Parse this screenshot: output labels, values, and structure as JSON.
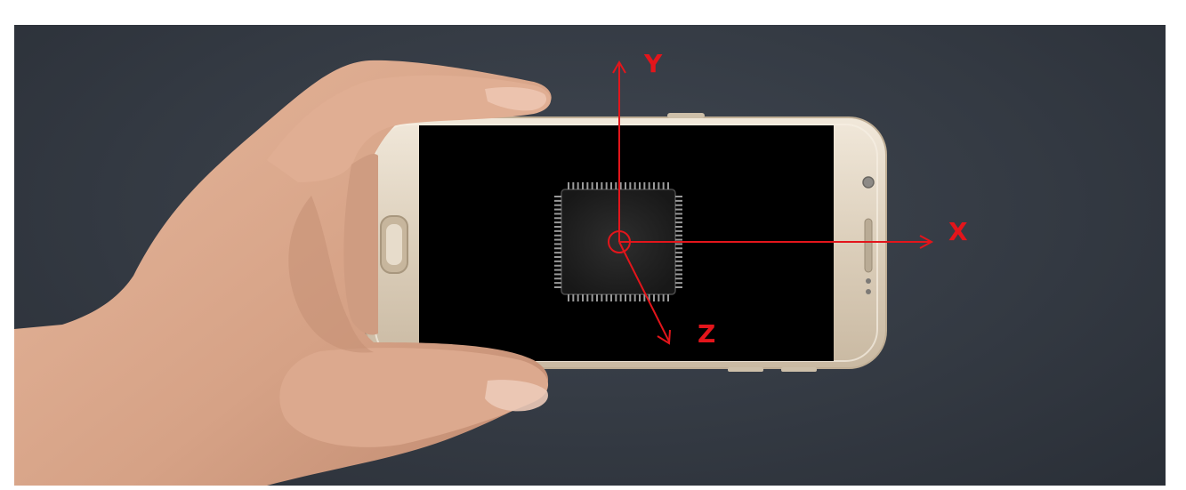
{
  "axes": {
    "x_label": "X",
    "y_label": "Y",
    "z_label": "Z"
  },
  "colors": {
    "background": "#3a4049",
    "axis": "#e3151b",
    "phone_body": "#e2d6c5",
    "screen": "#000000",
    "chip": "#2a2a2a",
    "skin": "#d9a98f"
  },
  "icons": {
    "chip": "microchip-icon",
    "hand": "hand-icon",
    "phone": "smartphone-icon"
  }
}
